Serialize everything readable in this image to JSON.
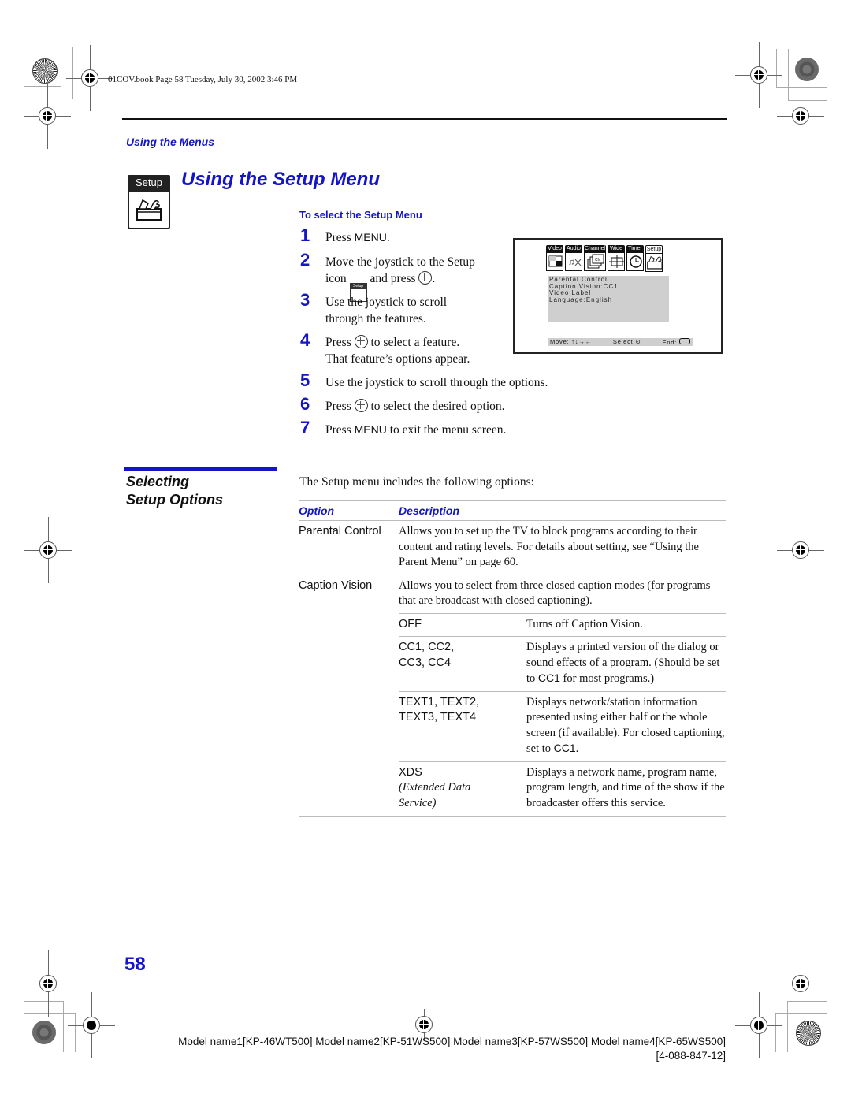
{
  "header": {
    "meta": "01COV.book  Page 58  Tuesday, July 30, 2002  3:46 PM",
    "section_label": "Using the Menus"
  },
  "setup_badge": {
    "label": "Setup",
    "icon": "toolbox-icon"
  },
  "title": "Using the Setup Menu",
  "procedure": {
    "heading": "To select the Setup Menu",
    "steps": [
      {
        "num": "1",
        "pre": "Press ",
        "key": "MENU",
        "post": "."
      },
      {
        "num": "2",
        "line1": "Move the joystick to the Setup",
        "pre": "icon",
        "mid": "and press",
        "post": ".",
        "mini_icon_label": "Setup"
      },
      {
        "num": "3",
        "line1": "Use the joystick to scroll",
        "line2": "through the features."
      },
      {
        "num": "4",
        "pre": "Press",
        "post": "to select a feature.",
        "line2": "That feature’s options appear."
      },
      {
        "num": "5",
        "text": "Use the joystick to scroll through the options."
      },
      {
        "num": "6",
        "pre": "Press",
        "post": "to select the desired option."
      },
      {
        "num": "7",
        "pre": "Press ",
        "key": "MENU",
        "post": " to exit the menu screen."
      }
    ]
  },
  "tv_screen": {
    "tabs": [
      "Video",
      "Audio",
      "Channel",
      "Wide",
      "Timer",
      "Setup"
    ],
    "selected_tab": "Setup",
    "menu_items": [
      "Parental Control",
      "Caption Vision:CC1",
      "Video Label",
      "Language:English"
    ],
    "footer": {
      "move": "Move: ↑↓→←",
      "select": "Select:⊙",
      "end": "End:"
    }
  },
  "options_section": {
    "title_line1": "Selecting",
    "title_line2": "Setup Options",
    "intro": "The Setup menu includes the following options:",
    "col_option": "Option",
    "col_description": "Description",
    "rows": [
      {
        "option": "Parental Control",
        "description": "Allows you to set up the TV to block programs according to their content and rating levels. For details about setting, see “Using the Parent Menu” on page 60."
      },
      {
        "option": "Caption Vision",
        "description": "Allows you to select from three closed caption modes (for programs that are broadcast with closed captioning).",
        "sub_options": [
          {
            "option": "OFF",
            "description": "Turns off Caption Vision."
          },
          {
            "option_line1": "CC1, CC2,",
            "option_line2": "CC3, CC4",
            "description_pre": "Displays a printed version of the dialog or sound effects of a program. (Should be set to ",
            "description_key": "CC1",
            "description_post": " for most programs.)"
          },
          {
            "option_line1": "TEXT1, TEXT2,",
            "option_line2": "TEXT3, TEXT4",
            "description_pre": "Displays network/station information presented using either half or the whole screen (if available). For closed captioning, set to ",
            "description_key": "CC1",
            "description_post": "."
          },
          {
            "option_line1": "XDS",
            "option_note1": "(Extended Data",
            "option_note2": "Service)",
            "description": "Displays a network name, program name, program length, and time of the show if the broadcaster offers this service."
          }
        ]
      }
    ]
  },
  "page_number": "58",
  "footer": {
    "models": "Model name1[KP-46WT500] Model name2[KP-51WS500] Model name3[KP-57WS500] Model name4[KP-65WS500]",
    "part_number": "[4-088-847-12]"
  },
  "colors": {
    "accent_blue": "#1414c8",
    "screen_gray": "#cfcfcf"
  }
}
